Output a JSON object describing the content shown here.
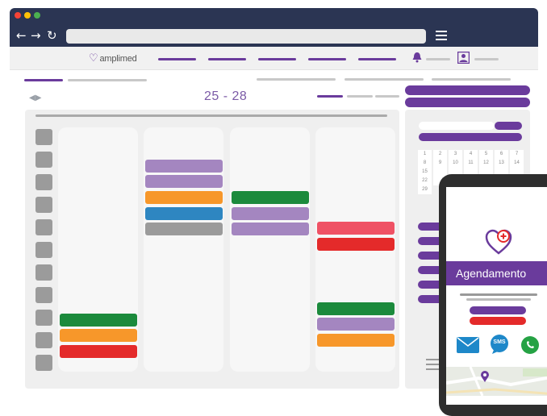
{
  "browser": {
    "back_icon": "arrow-left-icon",
    "forward_icon": "arrow-right-icon",
    "reload_icon": "reload-icon",
    "menu_icon": "hamburger-menu-icon",
    "title_dots": [
      "#f44336",
      "#ffc107",
      "#4caf50"
    ]
  },
  "app": {
    "logo_text": "amplimed",
    "brand_color": "#6a3b9c"
  },
  "calendar": {
    "week_range": "25 - 28",
    "events": [
      {
        "col": 0,
        "slot": 9,
        "color": "#1b8a3c"
      },
      {
        "col": 0,
        "slot": 10,
        "color": "#f7972a"
      },
      {
        "col": 0,
        "slot": 11,
        "color": "#e42a2a"
      },
      {
        "col": 1,
        "slot": 1,
        "color": "#a486c0"
      },
      {
        "col": 1,
        "slot": 2,
        "color": "#a486c0"
      },
      {
        "col": 1,
        "slot": 3,
        "color": "#f7972a"
      },
      {
        "col": 1,
        "slot": 4,
        "color": "#2e86c1"
      },
      {
        "col": 1,
        "slot": 5,
        "color": "#9b9b9b"
      },
      {
        "col": 2,
        "slot": 3,
        "color": "#1b8a3c"
      },
      {
        "col": 2,
        "slot": 4,
        "color": "#a486c0"
      },
      {
        "col": 2,
        "slot": 5,
        "color": "#a486c0"
      },
      {
        "col": 3,
        "slot": 5,
        "color": "#ef5265"
      },
      {
        "col": 3,
        "slot": 6,
        "color": "#e42a2a"
      },
      {
        "col": 3,
        "slot": 8,
        "color": "#1b8a3c"
      },
      {
        "col": 3,
        "slot": 9,
        "color": "#a486c0"
      },
      {
        "col": 3,
        "slot": 10,
        "color": "#f7972a"
      }
    ]
  },
  "mini_calendar": {
    "days": [
      "1",
      "2",
      "3",
      "4",
      "5",
      "6",
      "7",
      "8",
      "9",
      "10",
      "11",
      "12",
      "13",
      "14",
      "15",
      "",
      "",
      "",
      "",
      "",
      "",
      "22",
      "",
      "",
      "",
      "",
      "",
      "",
      "29"
    ]
  },
  "phone": {
    "banner_text": "Agendamento",
    "heart_icon": "heart-plus-icon",
    "mail_icon": "mail-icon",
    "sms_label": "SMS",
    "whatsapp_icon": "whatsapp-icon",
    "map_pin_icon": "map-pin-icon"
  }
}
